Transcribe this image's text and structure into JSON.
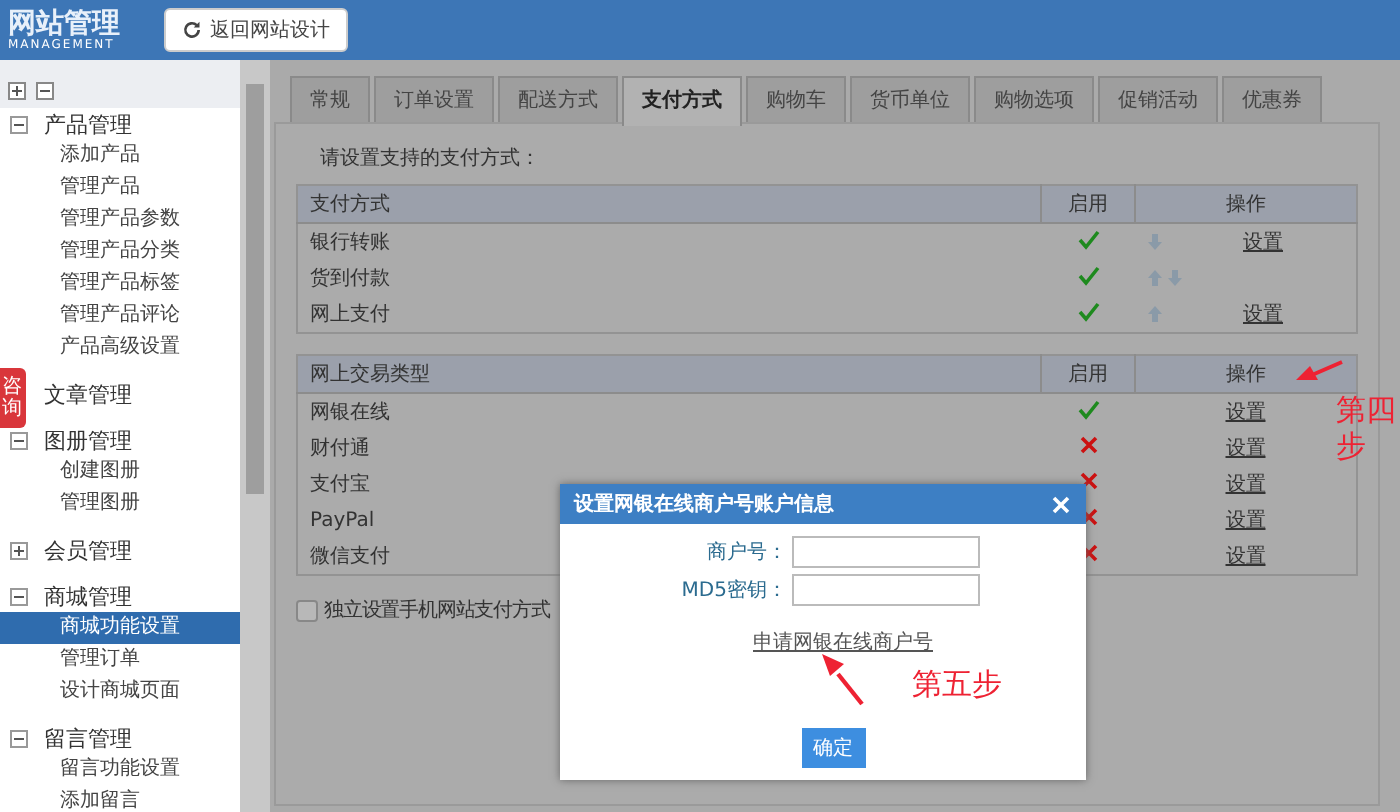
{
  "header": {
    "logo_title": "网站管理",
    "logo_subtitle": "MANAGEMENT",
    "back_button": "返回网站设计"
  },
  "sidebar": {
    "groups": [
      {
        "label": "产品管理",
        "expanded": true,
        "children": [
          {
            "label": "添加产品",
            "selected": false
          },
          {
            "label": "管理产品",
            "selected": false
          },
          {
            "label": "管理产品参数",
            "selected": false
          },
          {
            "label": "管理产品分类",
            "selected": false
          },
          {
            "label": "管理产品标签",
            "selected": false
          },
          {
            "label": "管理产品评论",
            "selected": false
          },
          {
            "label": "产品高级设置",
            "selected": false
          }
        ]
      },
      {
        "label": "文章管理"
      },
      {
        "label": "图册管理",
        "expanded": true,
        "children": [
          {
            "label": "创建图册",
            "selected": false
          },
          {
            "label": "管理图册",
            "selected": false
          }
        ]
      },
      {
        "label": "会员管理",
        "expanded": false
      },
      {
        "label": "商城管理",
        "expanded": true,
        "children": [
          {
            "label": "商城功能设置",
            "selected": true
          },
          {
            "label": "管理订单",
            "selected": false
          },
          {
            "label": "设计商城页面",
            "selected": false
          }
        ]
      },
      {
        "label": "留言管理",
        "expanded": true,
        "children": [
          {
            "label": "留言功能设置",
            "selected": false
          },
          {
            "label": "添加留言",
            "selected": false
          }
        ]
      }
    ]
  },
  "float_tab": {
    "label": "咨询"
  },
  "tabs": [
    {
      "label": "常规",
      "selected": false
    },
    {
      "label": "订单设置",
      "selected": false
    },
    {
      "label": "配送方式",
      "selected": false
    },
    {
      "label": "支付方式",
      "selected": true
    },
    {
      "label": "购物车",
      "selected": false
    },
    {
      "label": "货币单位",
      "selected": false
    },
    {
      "label": "购物选项",
      "selected": false
    },
    {
      "label": "促销活动",
      "selected": false
    },
    {
      "label": "优惠券",
      "selected": false
    }
  ],
  "prompt": "请设置支持的支付方式：",
  "payment_table": {
    "columns": [
      "支付方式",
      "启用",
      "操作"
    ],
    "rows": [
      {
        "name": "银行转账",
        "enabled": true,
        "can_move_up": false,
        "can_move_down": true,
        "action": "设置"
      },
      {
        "name": "货到付款",
        "enabled": true,
        "can_move_up": true,
        "can_move_down": true
      },
      {
        "name": "网上支付",
        "enabled": true,
        "can_move_up": true,
        "can_move_down": false,
        "action": "设置"
      }
    ]
  },
  "gateway_table": {
    "columns": [
      "网上交易类型",
      "启用",
      "操作"
    ],
    "rows": [
      {
        "name": "网银在线",
        "enabled": true,
        "action": "设置"
      },
      {
        "name": "财付通",
        "enabled": false,
        "action": "设置"
      },
      {
        "name": "支付宝",
        "enabled": false,
        "action": "设置"
      },
      {
        "name": "PayPal",
        "enabled": false,
        "action": "设置"
      },
      {
        "name": "微信支付",
        "enabled": false,
        "action": "设置"
      }
    ]
  },
  "mobile_option": {
    "label": "独立设置手机网站支付方式",
    "checked": false
  },
  "dialog": {
    "title": "设置网银在线商户号账户信息",
    "fields": [
      {
        "label": "商户号："
      },
      {
        "label": "MD5密钥："
      }
    ],
    "link": "申请网银在线商户号",
    "button": "确定"
  },
  "annotations": [
    {
      "text": "第四步"
    },
    {
      "text": "第五步"
    }
  ]
}
